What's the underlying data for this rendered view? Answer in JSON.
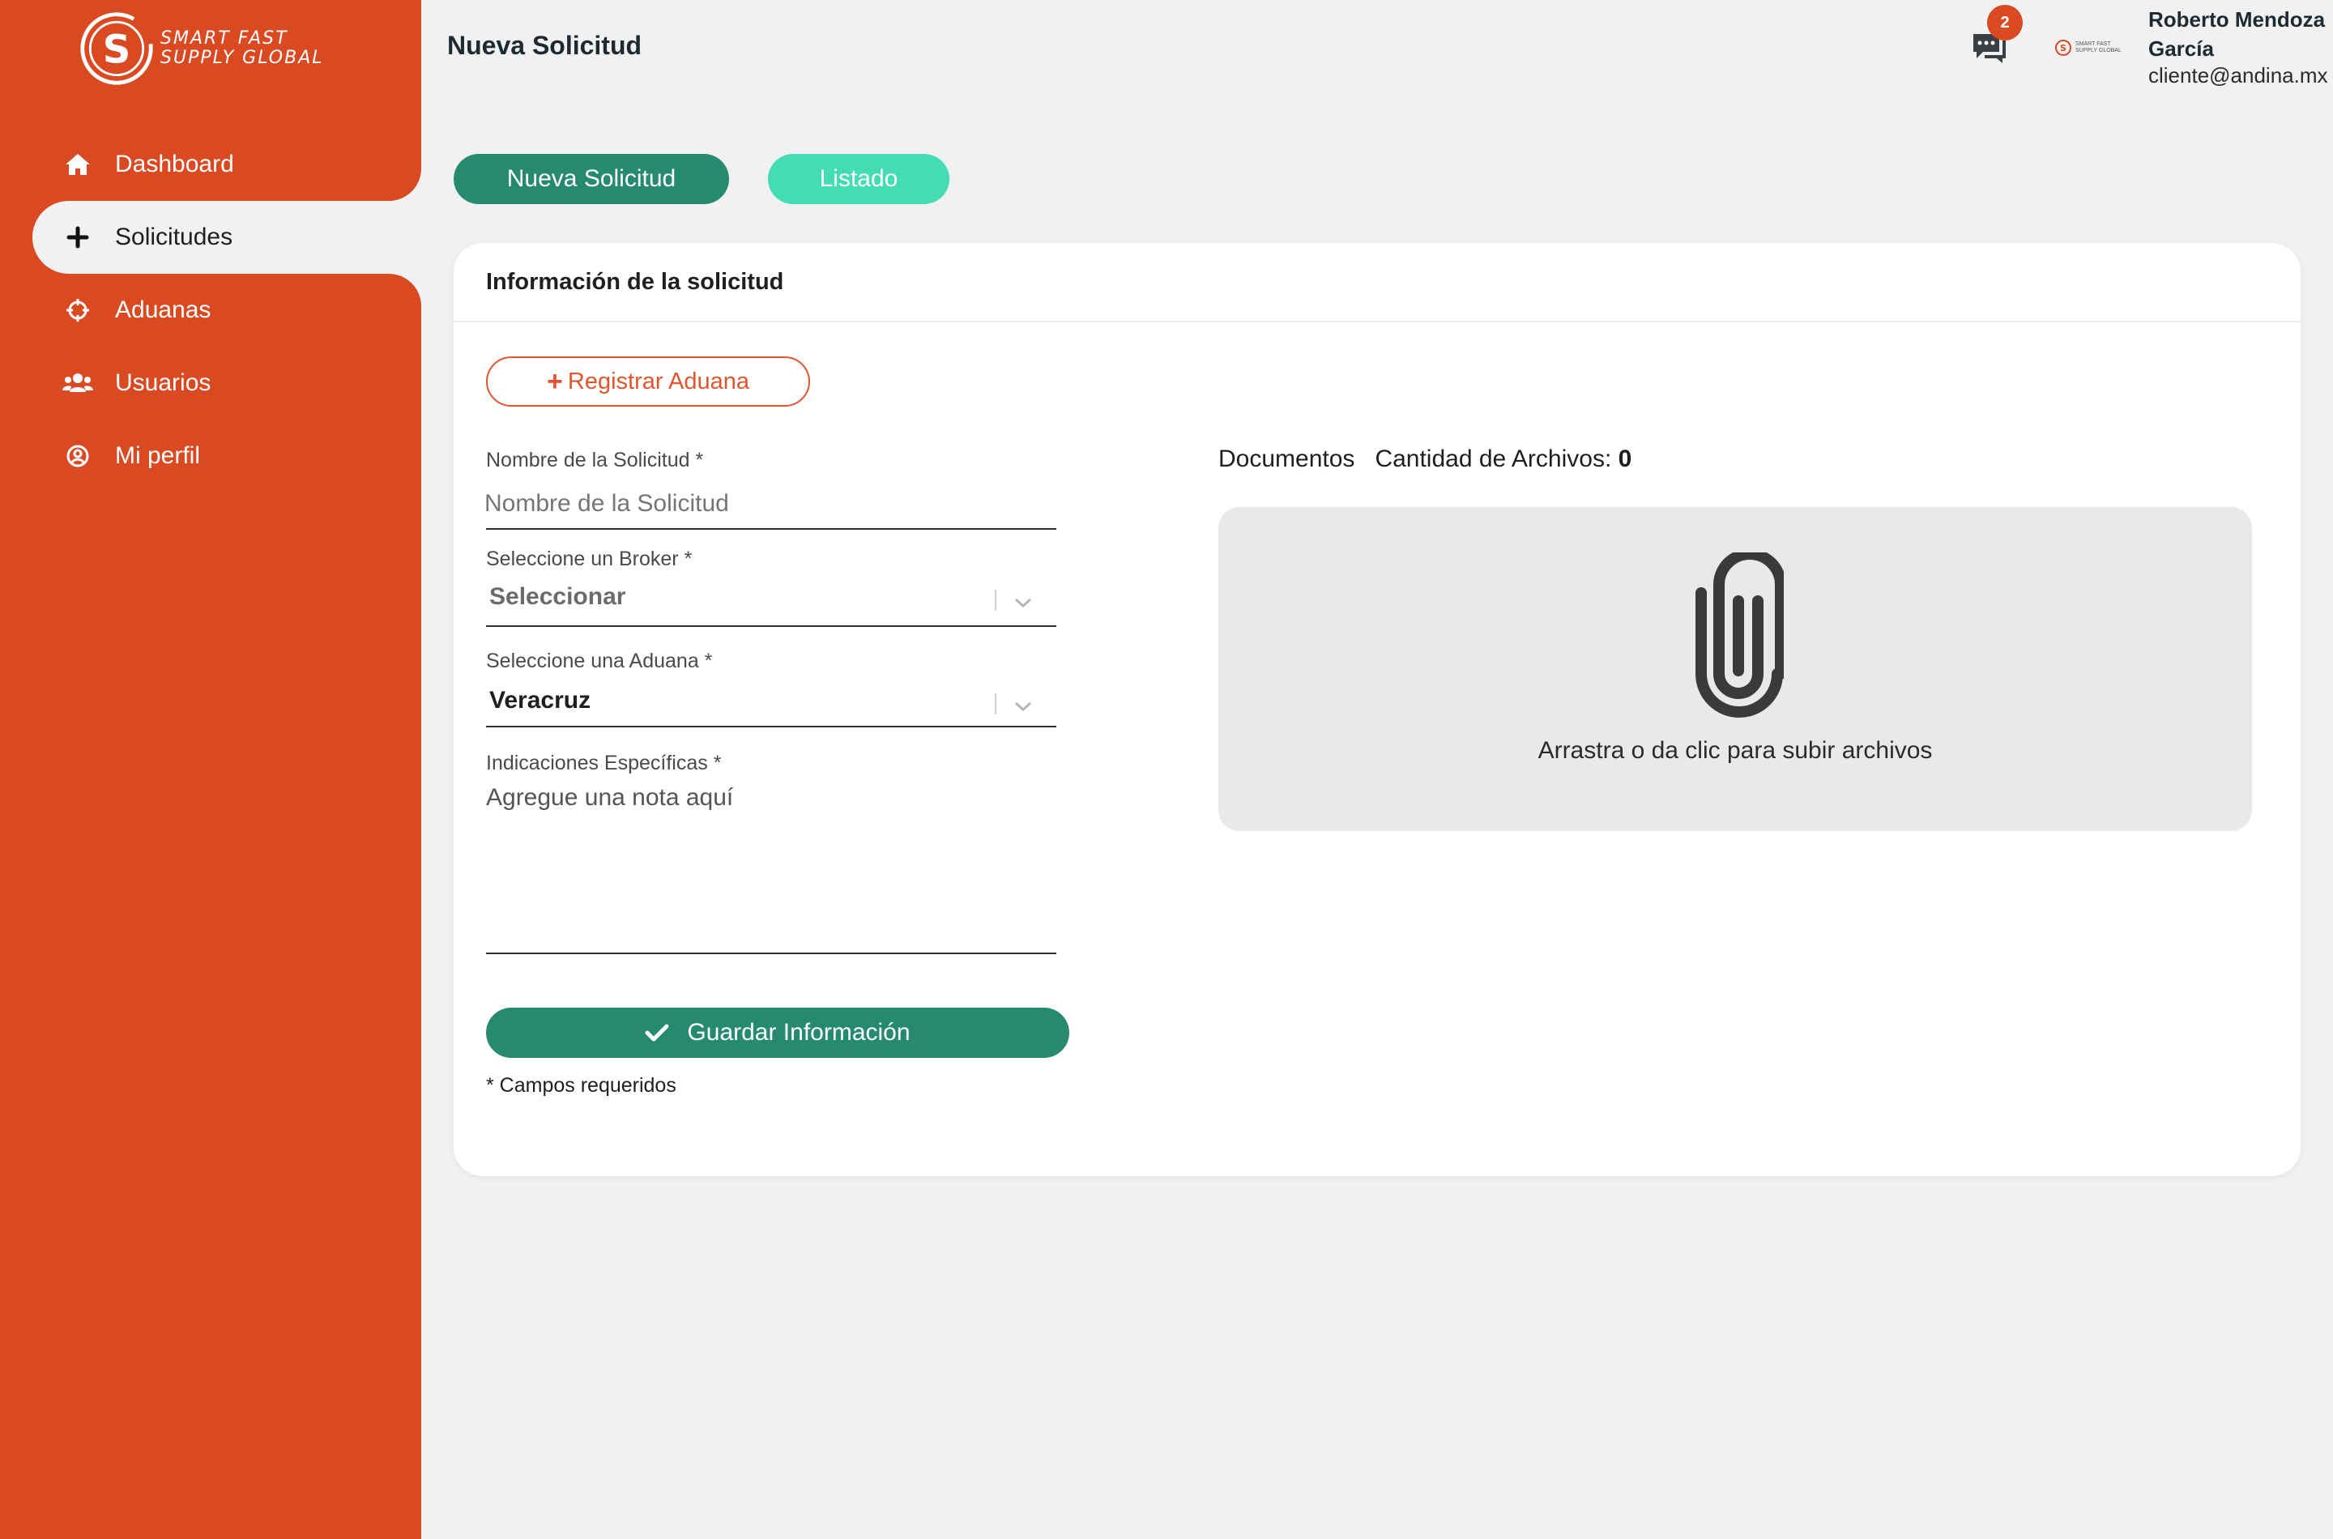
{
  "brand": {
    "name_line1": "SMART FAST",
    "name_line2": "SUPPLY GLOBAL",
    "primary_color": "#d94a22",
    "accent_green": "#268b6e",
    "accent_mint": "#43dcb4"
  },
  "sidebar": {
    "items": [
      {
        "label": "Dashboard",
        "icon": "home-icon"
      },
      {
        "label": "Solicitudes",
        "icon": "plus-icon",
        "active": true
      },
      {
        "label": "Aduanas",
        "icon": "crosshair-icon"
      },
      {
        "label": "Usuarios",
        "icon": "users-icon"
      },
      {
        "label": "Mi perfil",
        "icon": "user-circle-icon"
      }
    ]
  },
  "header": {
    "title": "Nueva Solicitud",
    "notifications_count": "2",
    "user_name": "Roberto Mendoza García",
    "user_email": "cliente@andina.mx"
  },
  "tabs": {
    "new_label": "Nueva Solicitud",
    "list_label": "Listado"
  },
  "form": {
    "card_title": "Información de la solicitud",
    "register_label": "Registrar Aduana",
    "name_label": "Nombre de la Solicitud *",
    "name_placeholder": "Nombre de la Solicitud",
    "broker_label": "Seleccione un Broker *",
    "broker_value": "Seleccionar",
    "aduana_label": "Seleccione una Aduana *",
    "aduana_value": "Veracruz",
    "notes_label": "Indicaciones Específicas *",
    "notes_placeholder": "Agregue una nota aquí",
    "save_label": "Guardar Información",
    "required_note": "* Campos requeridos"
  },
  "documents": {
    "title": "Documentos",
    "count_label": "Cantidad de Archivos:",
    "count_value": "0",
    "drop_text": "Arrastra o da clic para subir archivos"
  }
}
